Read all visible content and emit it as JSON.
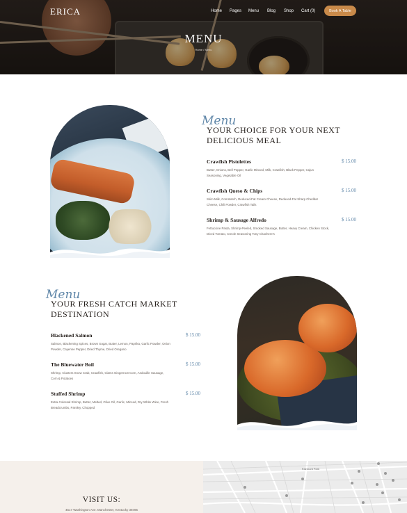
{
  "brand": {
    "logo": "ERICA"
  },
  "nav": {
    "items": [
      "Home",
      "Pages",
      "Menu",
      "Blog",
      "Shop",
      "Cart (0)"
    ],
    "cta": "Book A Table"
  },
  "hero": {
    "title": "MENU",
    "breadcrumb": "Home / Menu"
  },
  "section1": {
    "script": "Menu",
    "title_line1": "YOUR CHOICE FOR YOUR NEXT",
    "title_line2": "DELICIOUS MEAL",
    "items": [
      {
        "name": "Crawfish Pistolettes",
        "price": "$ 15.00",
        "desc1": "Butter, Onions, Bell Pepper, Garlic Minced, Milk, Crawfish, Black Pepper, Cajun",
        "desc2": "Seasoning, Vegetable Oil"
      },
      {
        "name": "Crawfish Queso & Chips",
        "price": "$ 15.00",
        "desc1": "Skim Milk, Cornstarch, Reduced-Fat Cream Cheese, Reduced-Fat Sharp Cheddar",
        "desc2": "Cheese, Chili Powder, Crawfish Tails"
      },
      {
        "name": "Shrimp & Sausage Alfredo",
        "price": "$ 15.00",
        "desc1": "Fettuccine Pasta, Shrimp-Peeled, Smoked Sausage, Butter, Heavy Cream, Chicken Stock,",
        "desc2": "Diced Tomato, Creole Seasoning Tony Chachere's"
      }
    ]
  },
  "section2": {
    "script": "Menu",
    "title_line1": "YOUR FRESH CATCH MARKET",
    "title_line2": "DESTINATION",
    "items": [
      {
        "name": "Blackened Salmon",
        "price": "$ 15.00",
        "desc1": "Salmon, Blackening Spices, Brown Sugar, Butter, Lemon, Paprika, Garlic Powder, Onion",
        "desc2": "Powder, Cayenne Pepper, Dried Thyme, Dried Oregano"
      },
      {
        "name": "The Bluewater Boil",
        "price": "$ 15.00",
        "desc1": "Shrimp, Clusters Snow Crab, Crawfish, Clams Gingerroot Corn, Andouille Sausage,",
        "desc2": "Corn & Potatoes"
      },
      {
        "name": "Stuffed Shrimp",
        "price": "$ 15.00",
        "desc1": "Extra Colossal Shrimp, Butter, Melted, Olive Oil, Garlic, Minced, Dry White Wine, Fresh",
        "desc2": "Breadcrumbs, Parsley, Chopped"
      }
    ]
  },
  "visit": {
    "title": "VISIT US:",
    "address": "4517 Washington Ave. Manchester, Kentucky 39495"
  },
  "map": {
    "label": "Fairmont Park"
  },
  "colors": {
    "accent": "#c98a4a",
    "script_blue": "#5f86a8",
    "visit_bg": "#f5f0eb"
  }
}
